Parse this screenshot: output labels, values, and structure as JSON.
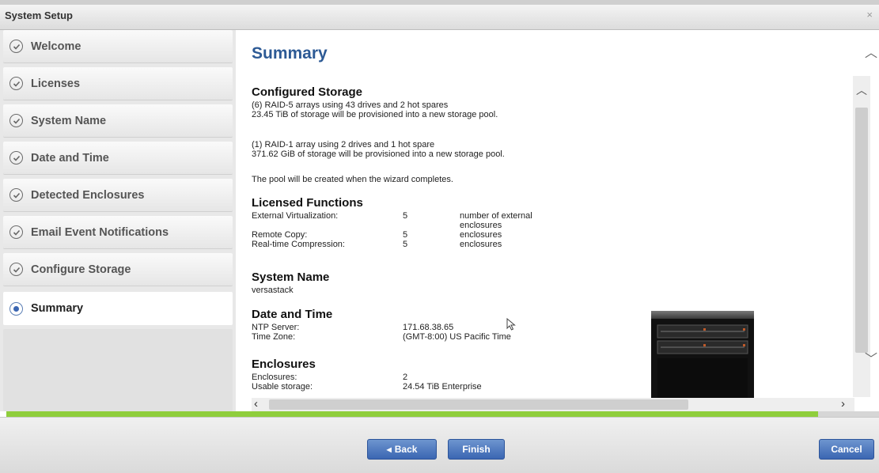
{
  "window": {
    "title": "System Setup",
    "close_symbol": "×"
  },
  "sidebar": {
    "items": [
      {
        "label": "Welcome",
        "state": "completed"
      },
      {
        "label": "Licenses",
        "state": "completed"
      },
      {
        "label": "System Name",
        "state": "completed"
      },
      {
        "label": "Date and Time",
        "state": "completed"
      },
      {
        "label": "Detected Enclosures",
        "state": "completed"
      },
      {
        "label": "Email Event Notifications",
        "state": "completed"
      },
      {
        "label": "Configure Storage",
        "state": "completed"
      },
      {
        "label": "Summary",
        "state": "current"
      }
    ]
  },
  "main": {
    "title": "Summary",
    "configured_storage": {
      "heading": "Configured Storage",
      "line1": "(6) RAID-5 arrays using 43 drives and 2 hot spares",
      "line2": "23.45 TiB of storage will be provisioned into a new storage pool.",
      "line3": "(1) RAID-1 array using 2 drives and 1 hot spare",
      "line4": "371.62 GiB of storage will be provisioned into a new storage pool.",
      "line5": "The pool will be created when the wizard completes."
    },
    "licensed_functions": {
      "heading": "Licensed Functions",
      "rows": [
        {
          "name": "External Virtualization:",
          "value": "5",
          "unit": "number of external enclosures"
        },
        {
          "name": "Remote Copy:",
          "value": "5",
          "unit": "enclosures"
        },
        {
          "name": "Real-time Compression:",
          "value": "5",
          "unit": "enclosures"
        }
      ]
    },
    "system_name": {
      "heading": "System Name",
      "value": "versastack"
    },
    "date_time": {
      "heading": "Date and Time",
      "ntp_label": "NTP Server:",
      "ntp_value": "171.68.38.65",
      "tz_label": "Time Zone:",
      "tz_value": "(GMT-8:00) US Pacific Time"
    },
    "enclosures": {
      "heading": "Enclosures",
      "count_label": "Enclosures:",
      "count_value": "2",
      "storage_label": "Usable storage:",
      "storage_value": "24.54 TiB Enterprise"
    }
  },
  "progress": {
    "fraction": 0.93,
    "color": "#8fce3c"
  },
  "footer": {
    "back_label": "Back",
    "finish_label": "Finish",
    "cancel_label": "Cancel"
  },
  "colors": {
    "accent": "#3b66b2",
    "title": "#2d5a95"
  }
}
